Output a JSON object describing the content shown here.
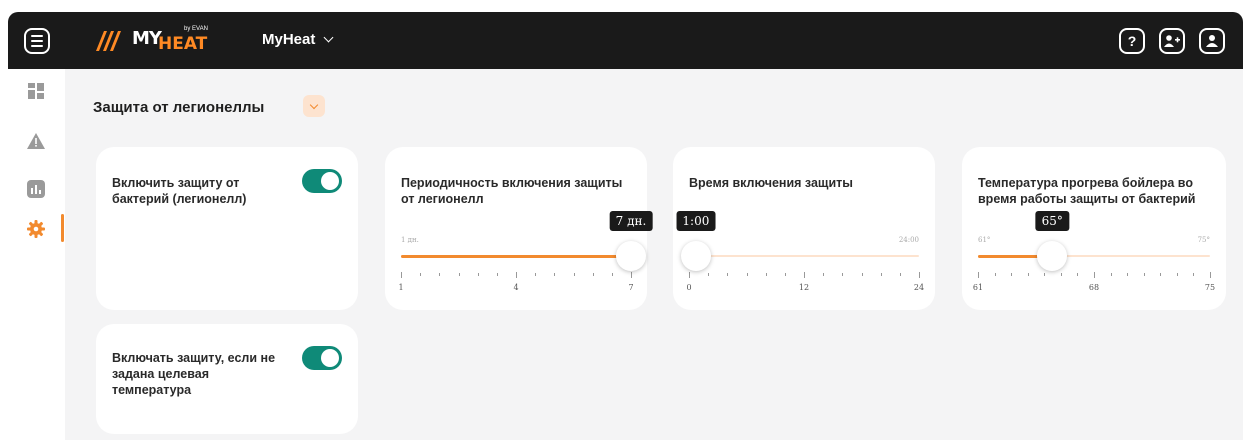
{
  "header": {
    "app_title": "MyHeat",
    "logo_my": "MY",
    "logo_heat": "HEAT",
    "logo_sub": "by EVAN"
  },
  "icons": {
    "menu": "menu-icon",
    "help": "help-icon",
    "add_user": "add-user-icon",
    "profile": "user-icon"
  },
  "header_labels": {
    "help": "?",
    "add_user": "+"
  },
  "sidebar": {
    "items": [
      {
        "name": "dashboard",
        "icon": "dashboard-icon",
        "active": false
      },
      {
        "name": "alerts",
        "icon": "warning-icon",
        "active": false
      },
      {
        "name": "stats",
        "icon": "chart-icon",
        "active": false
      },
      {
        "name": "settings",
        "icon": "gear-icon",
        "active": true
      }
    ]
  },
  "section": {
    "title": "Защита от легионеллы"
  },
  "cards": {
    "enable_protection": {
      "label": "Включить защиту от бактерий (легионелл)",
      "enabled": true
    },
    "enable_without_target": {
      "label": "Включать защиту, если не задана целевая температура",
      "enabled": true
    },
    "periodicity": {
      "label": "Периодичность включения защиты от легионелл",
      "value": 7,
      "min": 1,
      "max": 7,
      "tooltip": "7 дн.",
      "min_label": "1 дн.",
      "ticks": [
        1,
        2,
        3,
        4,
        5,
        6,
        7
      ],
      "tick_labels": [
        "1",
        "4",
        "7"
      ]
    },
    "time": {
      "label": "Время включения защиты",
      "value": 0,
      "min": 0,
      "max": 24,
      "tooltip": "1:00",
      "max_label": "24:00",
      "tick_labels": [
        "0",
        "12",
        "24"
      ]
    },
    "temperature": {
      "label": "Температура прогрева бойлера во время работы защиты от бактерий",
      "value": 65,
      "min": 61,
      "max": 75,
      "tooltip": "65°",
      "min_label": "61°",
      "max_label": "75°",
      "tick_labels": [
        "61",
        "68",
        "75"
      ]
    }
  },
  "colors": {
    "accent": "#f28a2e",
    "toggle_on": "#0f8a78",
    "topbar": "#1a1a1a",
    "background": "#f4f4f5"
  }
}
